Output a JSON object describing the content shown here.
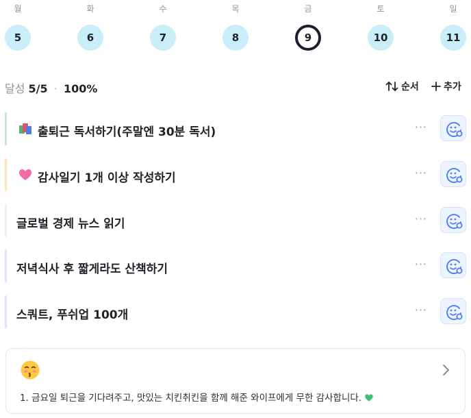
{
  "week": [
    {
      "label": "월",
      "date": "5"
    },
    {
      "label": "화",
      "date": "6"
    },
    {
      "label": "수",
      "date": "7"
    },
    {
      "label": "목",
      "date": "8"
    },
    {
      "label": "금",
      "date": "9",
      "selected": true
    },
    {
      "label": "토",
      "date": "10"
    },
    {
      "label": "일",
      "date": "11"
    }
  ],
  "summary": {
    "label": "달성",
    "count": "5/5",
    "separator": "·",
    "percent": "100%"
  },
  "actions": {
    "sort_label": "순서",
    "add_label": "추가",
    "sort_icon": "sort-arrows-icon",
    "add_icon": "plus-icon"
  },
  "tasks": [
    {
      "title": "출퇴근 독서하기(주말엔 30분 독서)",
      "emoji": "books-icon",
      "bar_color": "#bfe9d6"
    },
    {
      "title": "감사일기 1개 이상 작성하기",
      "emoji": "pink-heart-icon",
      "bar_color": "#fde3c4"
    },
    {
      "title": "글로벌 경제 뉴스 읽기",
      "emoji": "",
      "bar_color": "#eceef2"
    },
    {
      "title": "저녁식사 후 짧게라도 산책하기",
      "emoji": "",
      "bar_color": "#dde3f8"
    },
    {
      "title": "스쿼트, 푸쉬업 100개",
      "emoji": "",
      "bar_color": "#dde3f8"
    }
  ],
  "task_more_label": "···",
  "gratitude": {
    "face_icon": "kissing-face-icon",
    "text": "1. 금요일 퇴근을 기다려주고, 맛있는 치킨취킨을 함께 해준 와이프에게 무한 감사합니다.",
    "trailing_icon": "green-heart-icon"
  },
  "colors": {
    "day_circle": "#c9eef7",
    "selected_ring": "#1b2030",
    "check_bg": "#eef4ff",
    "check_icon": "#4f7ef2"
  }
}
